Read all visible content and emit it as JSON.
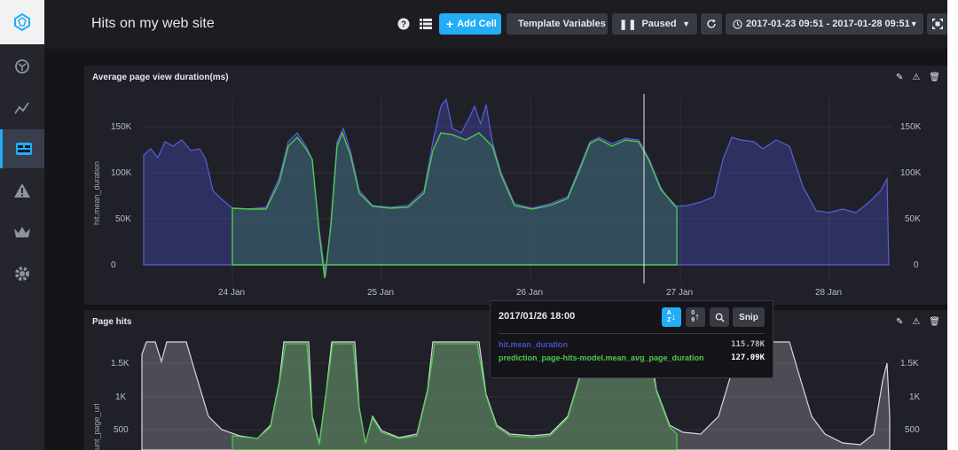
{
  "header": {
    "title": "Hits on my web site",
    "add_cell": "Add Cell",
    "template_variables": "Template Variables",
    "paused": "Paused",
    "time_range": "2017-01-23 09:51 - 2017-01-28 09:51"
  },
  "sidebar": {
    "items": [
      {
        "icon": "host-icon"
      },
      {
        "icon": "graph-icon"
      },
      {
        "icon": "dashboards-icon",
        "active": true
      },
      {
        "icon": "alert-icon"
      },
      {
        "icon": "crown-icon"
      },
      {
        "icon": "settings-icon"
      }
    ]
  },
  "panels": [
    {
      "title": "Average page view duration(ms)",
      "y_title": "hit.mean_duration",
      "y_ticks": [
        "150K",
        "100K",
        "50K",
        "0"
      ],
      "x_ticks": [
        "24 Jan",
        "25 Jan",
        "26 Jan",
        "27 Jan",
        "28 Jan"
      ]
    },
    {
      "title": "Page hits",
      "y_title": "unt_page_url",
      "y_ticks": [
        "1.5K",
        "1K",
        "500"
      ]
    }
  ],
  "tooltip": {
    "time": "2017/01/26 18:00",
    "sort_az": "A-Z",
    "sort_09": "0-9",
    "snip": "Snip",
    "rows": [
      {
        "name": "hit.mean_duration",
        "value": "115.78K",
        "color": "#4b4fc6"
      },
      {
        "name": "prediction_page-hits-model.mean_avg_page_duration",
        "value": "127.09K",
        "color": "#4ec74e"
      }
    ]
  },
  "colors": {
    "accent": "#22adf6",
    "series_actual": "#4b4fc6",
    "series_prediction": "#4ec74e",
    "series_hits": "#cfd2d8"
  }
}
